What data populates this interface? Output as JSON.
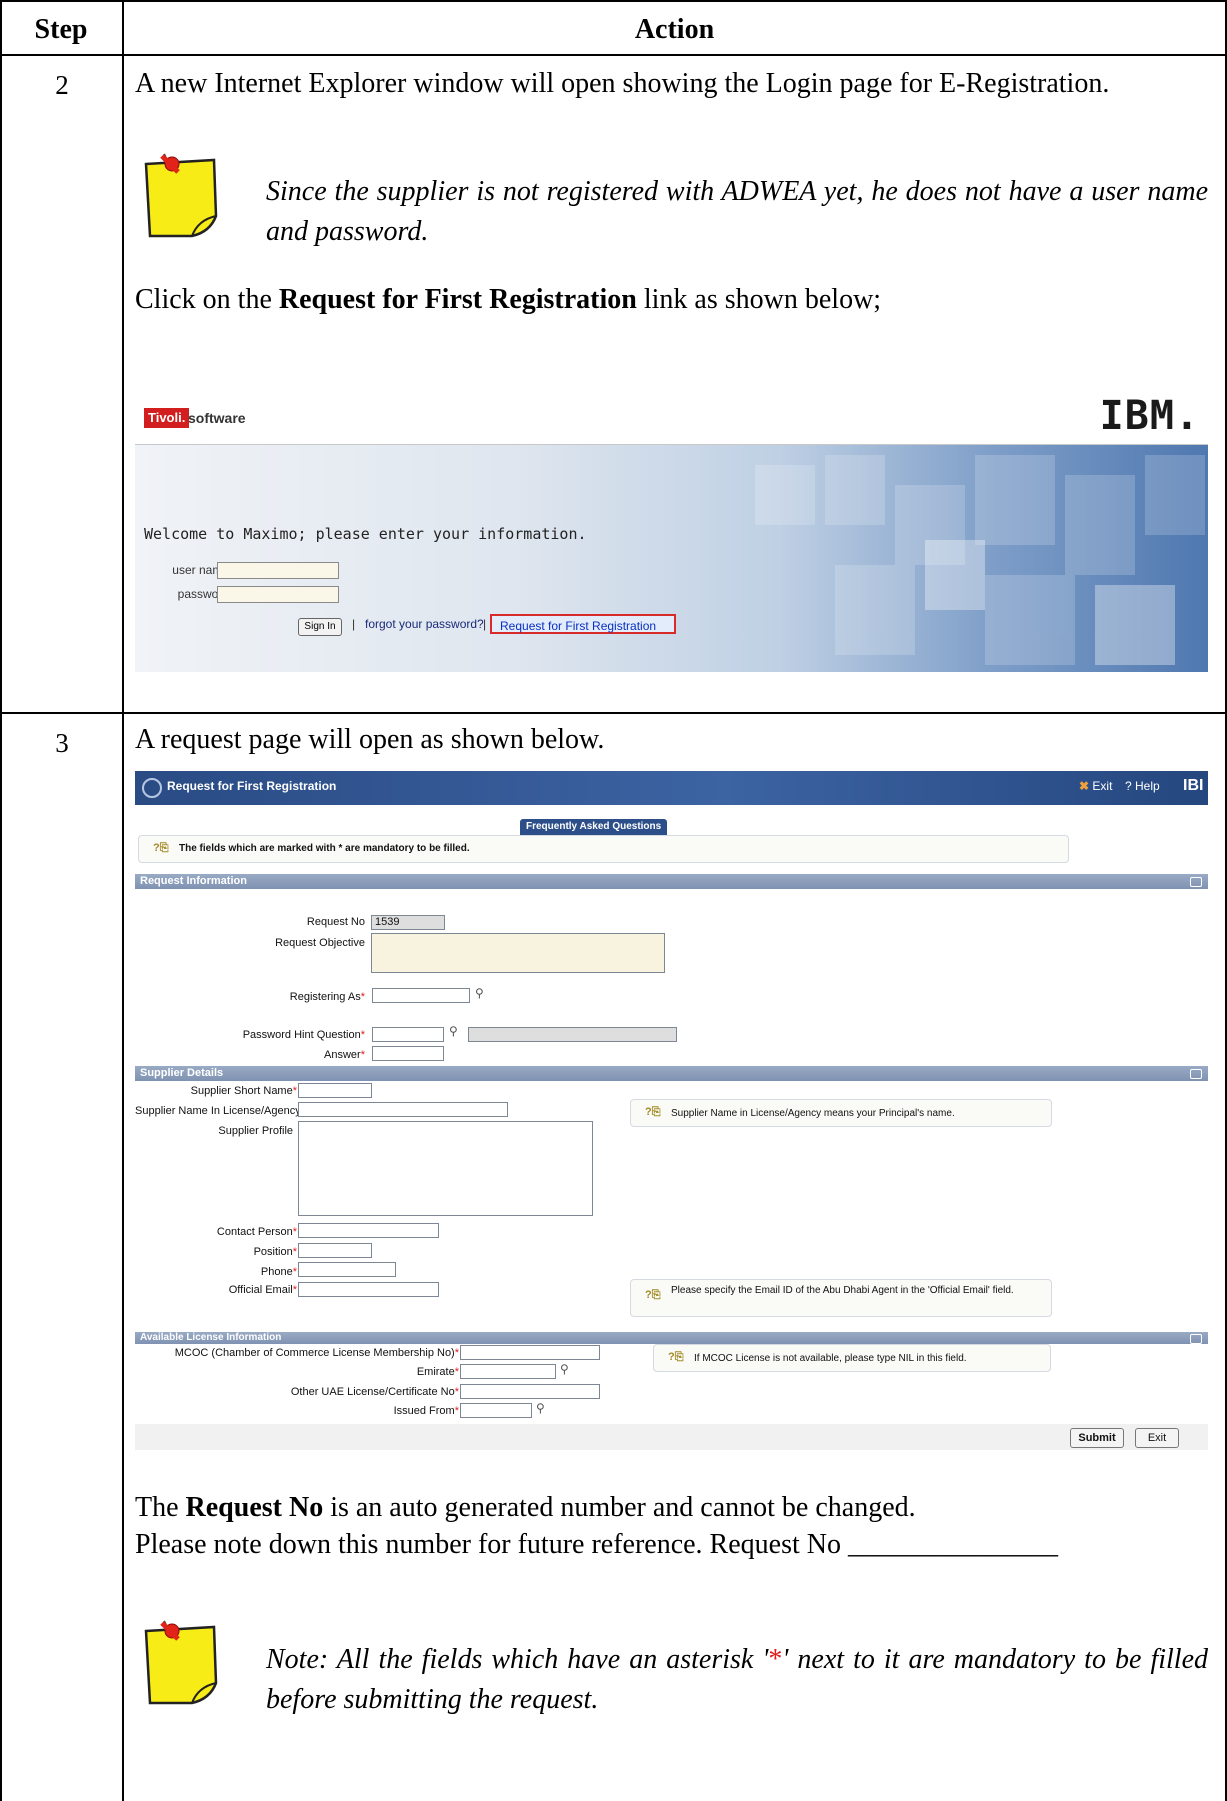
{
  "table": {
    "header_step": "Step",
    "header_action": "Action"
  },
  "step2": {
    "number": "2",
    "intro": "A new Internet Explorer window will open showing the Login page for E-Registration.",
    "note": "Since the supplier is not registered with ADWEA yet, he does not have a user name and password.",
    "instruction_prefix": "Click on the ",
    "instruction_bold": "Request for First Registration",
    "instruction_suffix": " link as shown below;"
  },
  "login_screen": {
    "brand_tag": "Tivoli.",
    "brand_text": "software",
    "vendor_logo": "IBM.",
    "welcome": "Welcome to Maximo; please enter your information.",
    "username_label": "user name",
    "password_label": "password",
    "signin_label": "Sign In",
    "sep1": "|",
    "forgot_link": "forgot your password?",
    "sep2": "|",
    "first_registration_link": "Request for First Registration"
  },
  "step3": {
    "number": "3",
    "intro": "A request page will open as shown below.",
    "reqno_line_bold": "Request No",
    "reqno_line_rest": " is an auto generated number and cannot be changed.",
    "reqno_line_prefix": "The ",
    "note_down_line": "Please note down this number for future reference. Request No _______________",
    "note_prefix": "Note: All the fields which have an asterisk '",
    "note_asterisk": "*",
    "note_suffix": "' next to it are mandatory to be filled before submitting the request."
  },
  "request_screen": {
    "title": "Request for First Registration",
    "exit_label": "Exit",
    "help_label": "? Help",
    "vendor_logo": "IBI",
    "faq_tab": "Frequently Asked Questions",
    "mandatory_info": "The fields which are marked with * are mandatory to be filled.",
    "section_request": "Request Information",
    "request_no_label": "Request No",
    "request_no_value": "1539",
    "request_objective_label": "Request Objective",
    "registering_as_label": "Registering As",
    "password_hint_label": "Password Hint Question",
    "answer_label": "Answer",
    "section_supplier": "Supplier Details",
    "supplier_short_name_label": "Supplier Short Name",
    "supplier_name_license_label": "Supplier Name In License/Agency",
    "supplier_profile_label": "Supplier Profile",
    "contact_person_label": "Contact Person",
    "position_label": "Position",
    "phone_label": "Phone",
    "official_email_label": "Official Email",
    "supplier_name_hint": "Supplier Name in License/Agency means your Principal's name.",
    "email_hint": "Please specify the Email ID of the Abu Dhabi Agent in the 'Official Email' field.",
    "section_license": "Available License Information",
    "mcoc_label": "MCOC (Chamber of Commerce License Membership No)",
    "emirate_label": "Emirate",
    "other_license_label": "Other UAE License/Certificate No",
    "issued_from_label": "Issued From",
    "mcoc_hint": "If MCOC License is not available, please type NIL in this field.",
    "asterisk": "*",
    "submit_label": "Submit",
    "exit_button_label": "Exit"
  },
  "colors": {
    "title_bar": "#2a4b84",
    "section_bar": "#8a9bb8",
    "mandatory_asterisk": "#e01c1c",
    "highlight_box": "#d82a2a",
    "sticky_note": "#f7ec16"
  }
}
